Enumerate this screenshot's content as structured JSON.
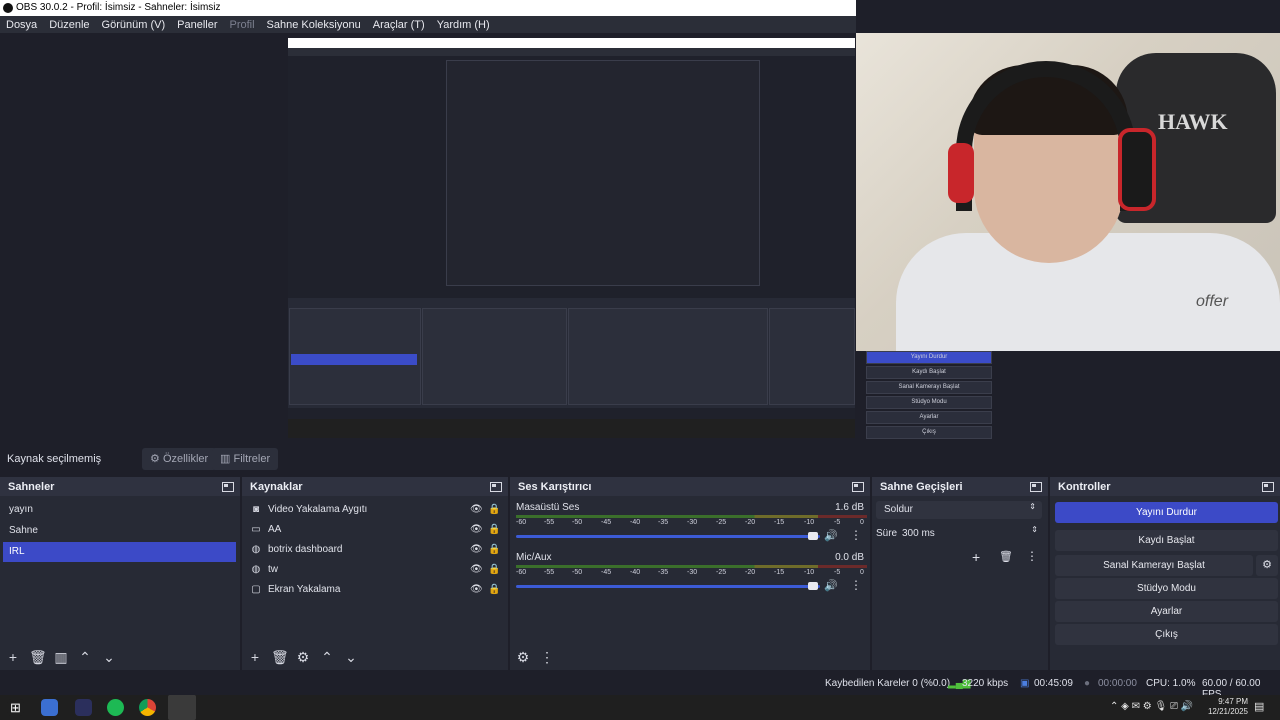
{
  "window": {
    "title": "OBS 30.0.2 - Profil: İsimsiz - Sahneler: İsimsiz"
  },
  "menu": [
    "Dosya",
    "Düzenle",
    "Görünüm (V)",
    "Paneller",
    "Profil",
    "Sahne Koleksiyonu",
    "Araçlar (T)",
    "Yardım (H)"
  ],
  "preview": {
    "webcam_chair_text": "HAWK",
    "webcam_shirt_text": "offer",
    "overlay_menu": [
      "Yayını Durdur",
      "Kaydı Başlat",
      "Sanal Kamerayı Başlat",
      "Stüdyo Modu",
      "Ayarlar",
      "Çıkış"
    ]
  },
  "source_bar": {
    "label": "Kaynak seçilmemiş",
    "properties": "Özellikler",
    "filters": "Filtreler"
  },
  "scenes": {
    "title": "Sahneler",
    "items": [
      "yayın",
      "Sahne",
      "IRL"
    ],
    "selected": "IRL"
  },
  "sources": {
    "title": "Kaynaklar",
    "items": [
      {
        "name": "Video Yakalama Aygıtı",
        "icon": "camera-icon"
      },
      {
        "name": "AA",
        "icon": "window-icon"
      },
      {
        "name": "botrix dashboard",
        "icon": "globe-icon"
      },
      {
        "name": "tw",
        "icon": "globe-icon"
      },
      {
        "name": "Ekran Yakalama",
        "icon": "monitor-icon"
      }
    ]
  },
  "mixer": {
    "title": "Ses Karıştırıcı",
    "scale": [
      "-60",
      "-55",
      "-50",
      "-45",
      "-40",
      "-35",
      "-30",
      "-25",
      "-20",
      "-15",
      "-10",
      "-5",
      "0"
    ],
    "channels": [
      {
        "name": "Masaüstü Ses",
        "db": "1.6 dB",
        "level": 0.95
      },
      {
        "name": "Mic/Aux",
        "db": "0.0 dB",
        "level": 0.95
      }
    ]
  },
  "transitions": {
    "title": "Sahne Geçişleri",
    "selected": "Soldur",
    "duration_label": "Süre",
    "duration_value": "300 ms"
  },
  "controls": {
    "title": "Kontroller",
    "buttons": [
      "Yayını Durdur",
      "Kaydı Başlat",
      "Sanal Kamerayı Başlat",
      "Stüdyo Modu",
      "Ayarlar",
      "Çıkış"
    ]
  },
  "status": {
    "dropped": "Kaybedilen Kareler 0 (%0.0)",
    "bitrate": "3220 kbps",
    "stream_time": "00:45:09",
    "rec_time": "00:00:00",
    "cpu": "CPU: 1.0%",
    "fps": "60.00 / 60.00 FPS"
  },
  "taskbar": {
    "time": "9:47 PM",
    "date": "12/21/2025"
  },
  "colors": {
    "accent": "#3c4ac7",
    "panel": "#272a35",
    "header": "#2f3240"
  }
}
